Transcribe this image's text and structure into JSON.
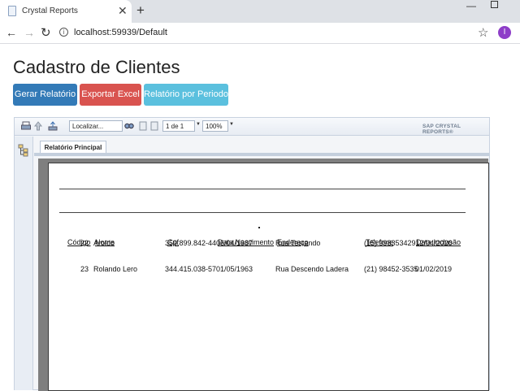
{
  "browser": {
    "tab_title": "Crystal Reports",
    "close_glyph": "✕",
    "new_tab_glyph": "+",
    "url": "localhost:59939/Default",
    "profile_initial": "I",
    "profile_color": "#8e3ec8"
  },
  "page": {
    "title": "Cadastro de Clientes",
    "buttons": {
      "gerar": "Gerar Relatório",
      "excel": "Exportar Excel",
      "periodo": "Relatório por Periodo"
    },
    "button_colors": {
      "gerar": "#337ab7",
      "excel": "#d9534f",
      "periodo": "#5bc0de"
    }
  },
  "viewer": {
    "search_placeholder": "Localizar...",
    "page_indicator": "1 de 1",
    "zoom": "100%",
    "brand": "SAP CRYSTAL REPORTS®",
    "tab_label": "Relatório Principal",
    "icons": [
      "print-icon",
      "export-icon",
      "up-icon",
      "find-icon",
      "first-page-icon",
      "prev-page-icon",
      "tree-toggle-icon"
    ]
  },
  "report": {
    "columns": [
      "Código",
      "Nome",
      "Cpf",
      "Data Nascimento",
      "Endereço",
      "Telefone",
      "Data Inclusão"
    ],
    "rows": [
      {
        "codigo": "22",
        "nome": "Aroldo",
        "cpf": "359.899.842-44",
        "nascimento": "06/04/1987",
        "endereco": "Rua Testando",
        "telefone": "(15) 99835342912/04/2020",
        "inclusao": ""
      },
      {
        "codigo": "23",
        "nome": "Rolando Lero",
        "cpf": "344.415.038-57",
        "nascimento": "01/05/1963",
        "endereco": "Rua Descendo Ladera",
        "telefone": "(21) 98452-3535",
        "inclusao": "01/02/2019"
      }
    ]
  }
}
